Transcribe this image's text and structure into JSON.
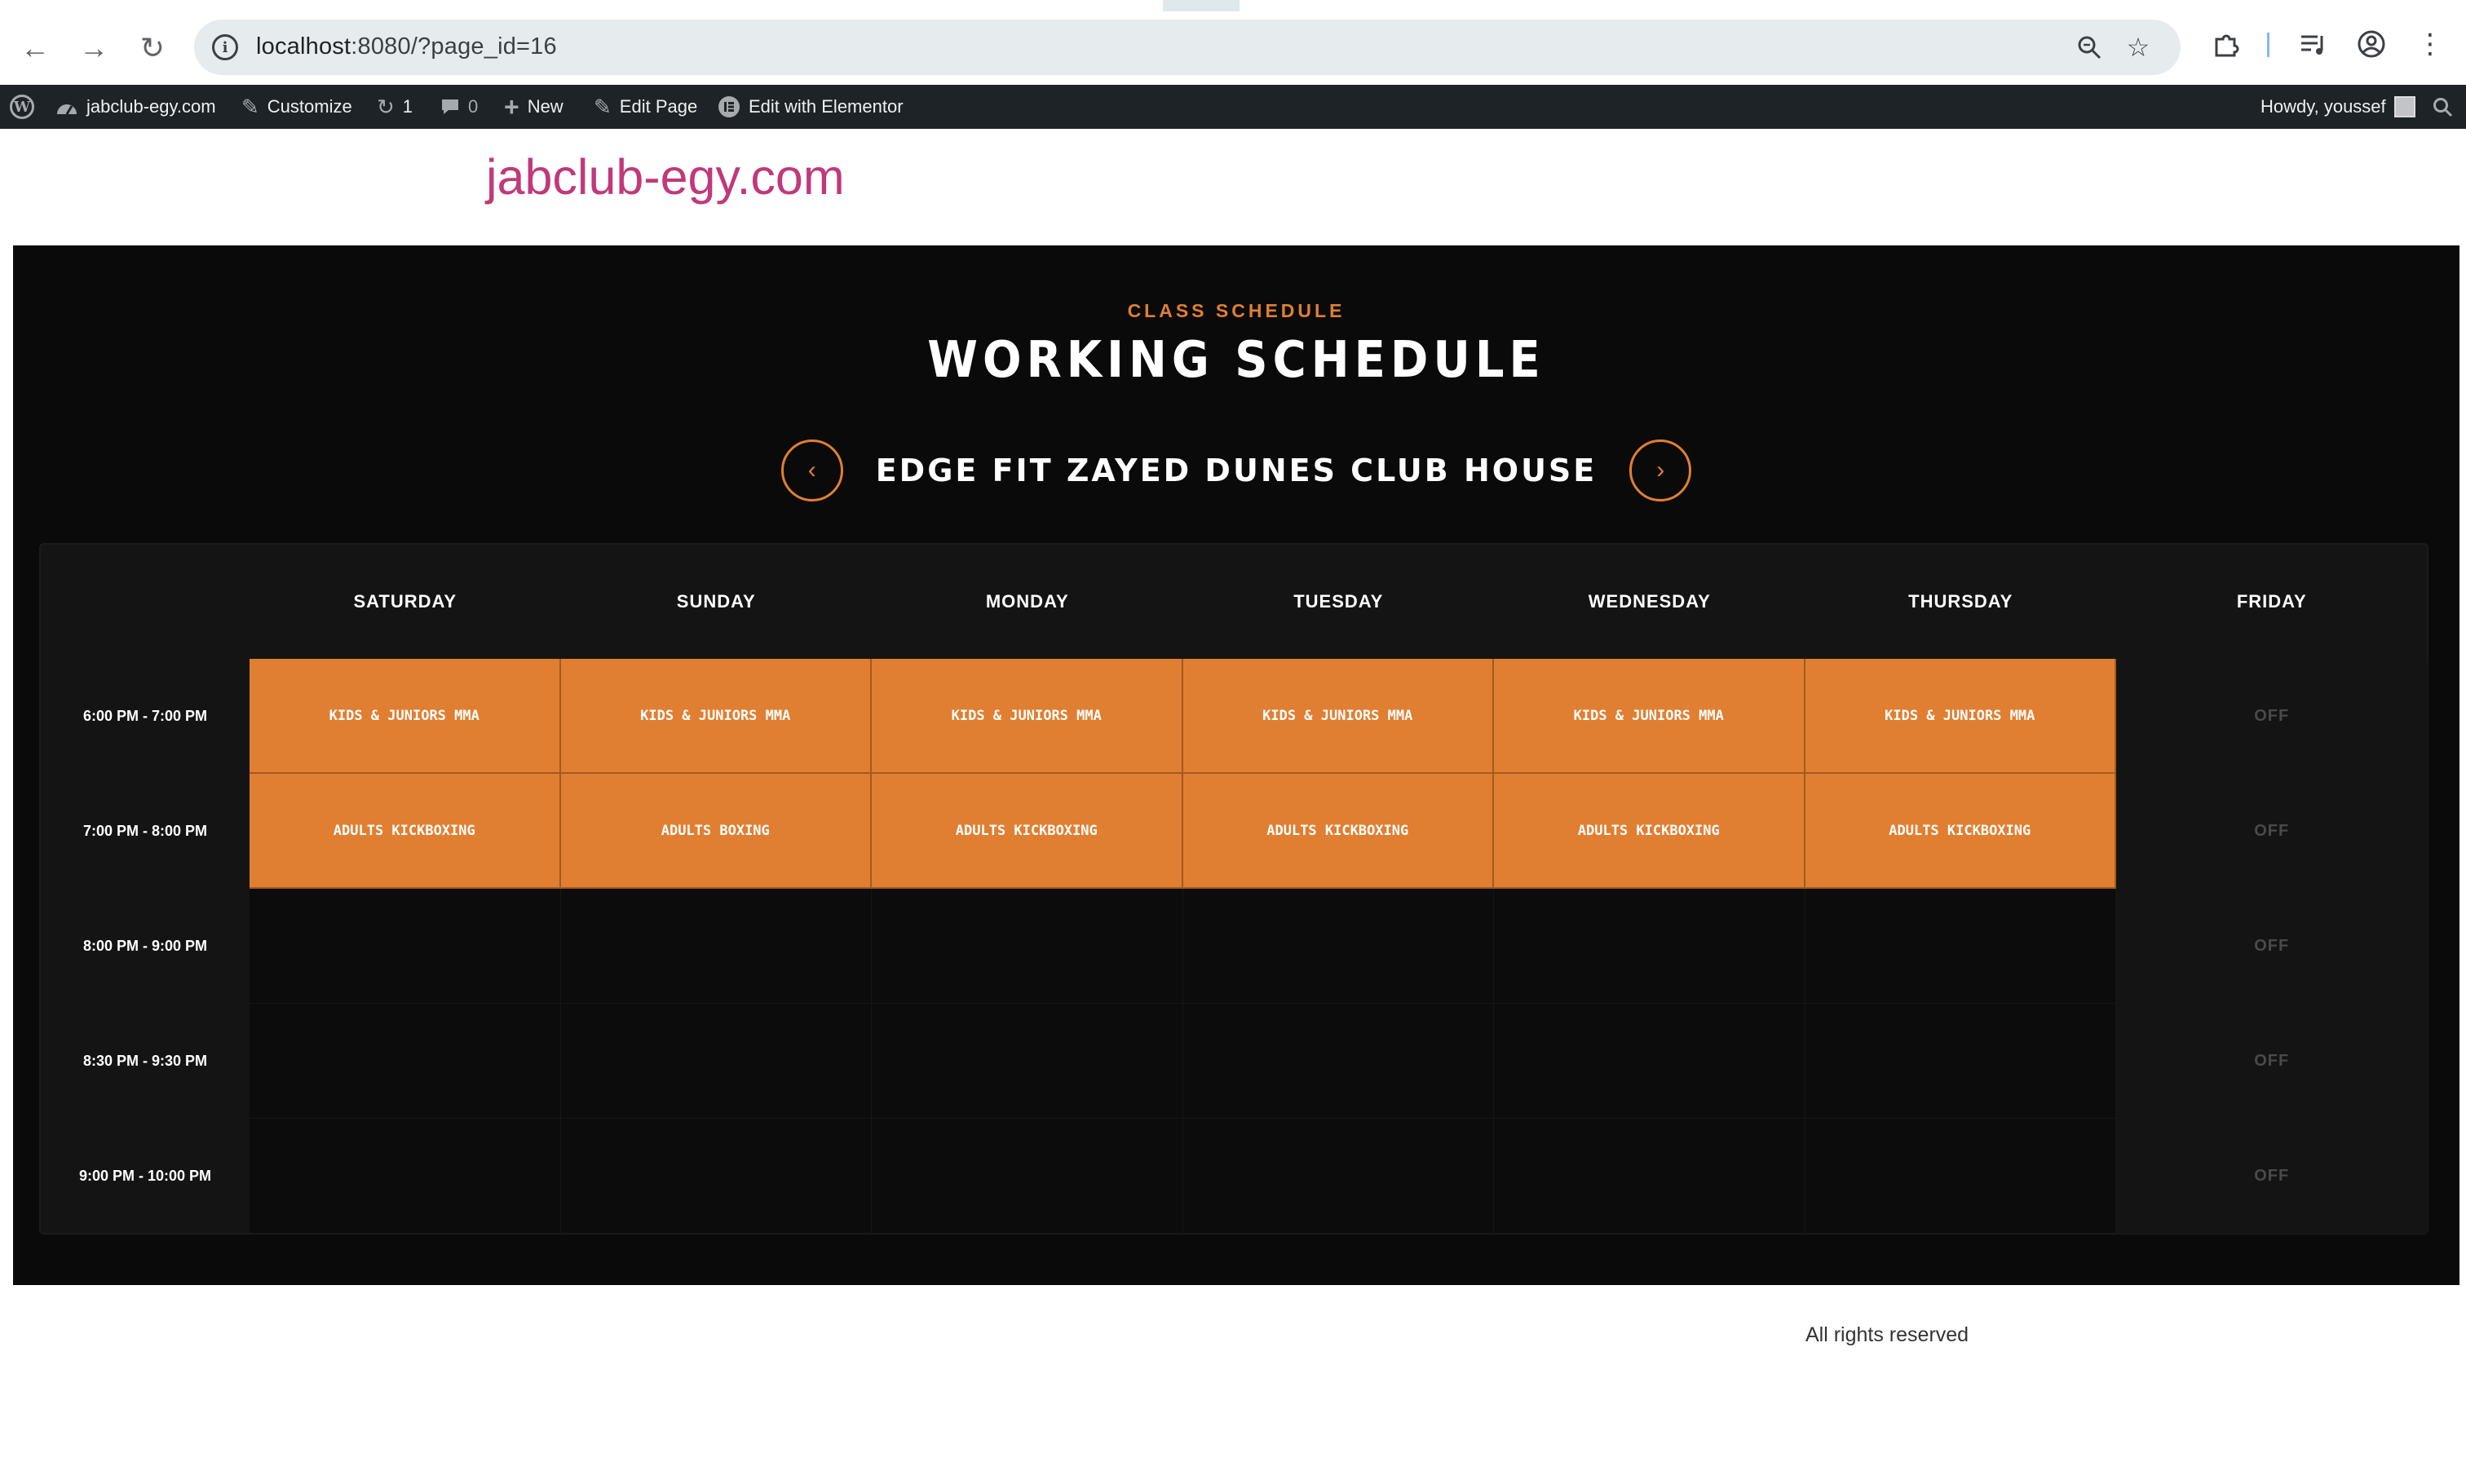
{
  "browser": {
    "url_host": "localhost",
    "url_rest": ":8080/?page_id=16",
    "icons": [
      "back-icon",
      "forward-icon",
      "reload-icon",
      "site-info-icon",
      "zoom-icon",
      "bookmark-star-icon",
      "extensions-icon",
      "media-control-icon",
      "profile-icon",
      "menu-icon"
    ]
  },
  "adminbar": {
    "site_name": "jabclub-egy.com",
    "customize": "Customize",
    "updates_count": "1",
    "comments_count": "0",
    "new": "New",
    "edit_page": "Edit Page",
    "edit_elementor": "Edit with Elementor",
    "howdy": "Howdy, youssef"
  },
  "site": {
    "title": "jabclub-egy.com",
    "title_color": "#c0397a"
  },
  "schedule": {
    "kicker": "CLASS SCHEDULE",
    "title": "WORKING SCHEDULE",
    "location": "EDGE FIT ZAYED DUNES CLUB HOUSE",
    "prev_symbol": "‹",
    "next_symbol": "›",
    "accent_color": "#e07f32",
    "days": [
      "SATURDAY",
      "SUNDAY",
      "MONDAY",
      "TUESDAY",
      "WEDNESDAY",
      "THURSDAY",
      "FRIDAY"
    ],
    "rows": [
      {
        "time": "6:00 PM - 7:00 PM",
        "cells": [
          "KIDS & JUNIORS MMA",
          "KIDS & JUNIORS MMA",
          "KIDS & JUNIORS MMA",
          "KIDS & JUNIORS MMA",
          "KIDS & JUNIORS MMA",
          "KIDS & JUNIORS MMA",
          "OFF"
        ]
      },
      {
        "time": "7:00 PM - 8:00 PM",
        "cells": [
          "ADULTS KICKBOXING",
          "ADULTS BOXING",
          "ADULTS KICKBOXING",
          "ADULTS KICKBOXING",
          "ADULTS KICKBOXING",
          "ADULTS KICKBOXING",
          "OFF"
        ]
      },
      {
        "time": "8:00 PM - 9:00 PM",
        "cells": [
          "",
          "",
          "",
          "",
          "",
          "",
          "OFF"
        ]
      },
      {
        "time": "8:30 PM - 9:30 PM",
        "cells": [
          "",
          "",
          "",
          "",
          "",
          "",
          "OFF"
        ]
      },
      {
        "time": "9:00 PM - 10:00 PM",
        "cells": [
          "",
          "",
          "",
          "",
          "",
          "",
          "OFF"
        ]
      }
    ]
  },
  "footer": {
    "text": "All rights reserved"
  }
}
